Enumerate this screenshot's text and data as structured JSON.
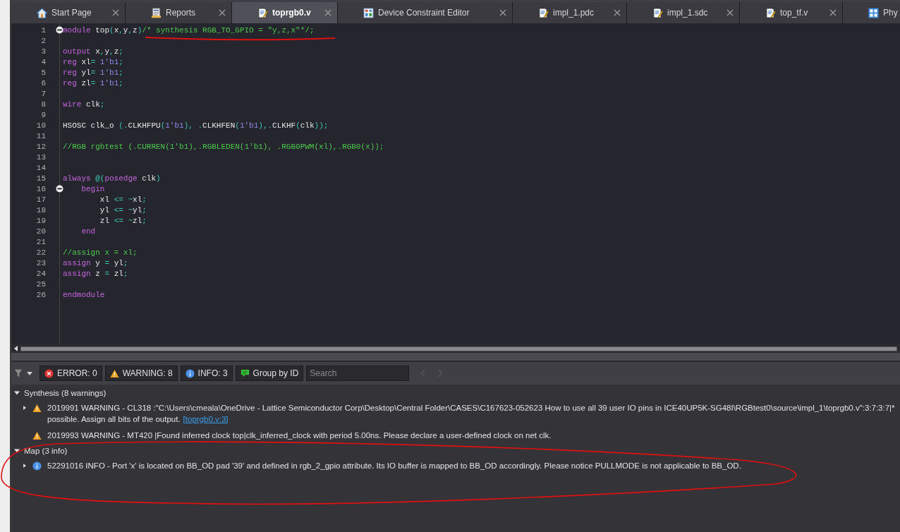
{
  "tabs": [
    {
      "label": "Start Page",
      "kind": "home",
      "selected": false,
      "closable": true
    },
    {
      "label": "Reports",
      "kind": "report",
      "selected": false,
      "closable": true
    },
    {
      "label": "toprgb0.v",
      "kind": "file",
      "selected": true,
      "closable": true
    },
    {
      "label": "Device Constraint Editor",
      "kind": "table",
      "selected": false,
      "closable": true
    },
    {
      "label": "impl_1.pdc",
      "kind": "file",
      "selected": false,
      "closable": true
    },
    {
      "label": "impl_1.sdc",
      "kind": "file",
      "selected": false,
      "closable": true
    },
    {
      "label": "top_tf.v",
      "kind": "file",
      "selected": false,
      "closable": true
    },
    {
      "label": "Phy",
      "kind": "grid",
      "selected": false,
      "closable": false
    }
  ],
  "editor": {
    "lines": [
      {
        "number": "1",
        "fold": true,
        "tokens": [
          {
            "kind": "k",
            "text": "module"
          },
          {
            "kind": "t",
            "text": " top"
          },
          {
            "kind": "p",
            "text": "("
          },
          {
            "kind": "t",
            "text": "x"
          },
          {
            "kind": "p",
            "text": ","
          },
          {
            "kind": "t",
            "text": "y"
          },
          {
            "kind": "p",
            "text": ","
          },
          {
            "kind": "t",
            "text": "z"
          },
          {
            "kind": "p",
            "text": ")"
          },
          {
            "kind": "c",
            "text": "/* synthesis RGB_TO_GPIO = \"y,z,x\"*/;"
          }
        ]
      },
      {
        "number": "2",
        "fold": false
      },
      {
        "number": "3",
        "fold": false,
        "tokens": [
          {
            "kind": "k",
            "text": "output"
          },
          {
            "kind": "t",
            "text": " x"
          },
          {
            "kind": "p",
            "text": ","
          },
          {
            "kind": "t",
            "text": "y"
          },
          {
            "kind": "p",
            "text": ","
          },
          {
            "kind": "t",
            "text": "z"
          },
          {
            "kind": "p",
            "text": ";"
          }
        ]
      },
      {
        "number": "4",
        "fold": false,
        "tokens": [
          {
            "kind": "k",
            "text": "reg"
          },
          {
            "kind": "t",
            "text": " xl"
          },
          {
            "kind": "p",
            "text": "= "
          },
          {
            "kind": "n",
            "text": "1'b1"
          },
          {
            "kind": "p",
            "text": ";"
          }
        ]
      },
      {
        "number": "5",
        "fold": false,
        "tokens": [
          {
            "kind": "k",
            "text": "reg"
          },
          {
            "kind": "t",
            "text": " yl"
          },
          {
            "kind": "p",
            "text": "= "
          },
          {
            "kind": "n",
            "text": "1'b1"
          },
          {
            "kind": "p",
            "text": ";"
          }
        ]
      },
      {
        "number": "6",
        "fold": false,
        "tokens": [
          {
            "kind": "k",
            "text": "reg"
          },
          {
            "kind": "t",
            "text": " zl"
          },
          {
            "kind": "p",
            "text": "= "
          },
          {
            "kind": "n",
            "text": "1'b1"
          },
          {
            "kind": "p",
            "text": ";"
          }
        ]
      },
      {
        "number": "7",
        "fold": false
      },
      {
        "number": "8",
        "fold": false,
        "tokens": [
          {
            "kind": "k",
            "text": "wire"
          },
          {
            "kind": "t",
            "text": " clk"
          },
          {
            "kind": "p",
            "text": ";"
          }
        ]
      },
      {
        "number": "9",
        "fold": false
      },
      {
        "number": "10",
        "fold": false,
        "tokens": [
          {
            "kind": "t",
            "text": "HSOSC clk_o "
          },
          {
            "kind": "p",
            "text": "(."
          },
          {
            "kind": "t",
            "text": "CLKHFPU"
          },
          {
            "kind": "p",
            "text": "("
          },
          {
            "kind": "n",
            "text": "1'b1"
          },
          {
            "kind": "p",
            "text": "), ."
          },
          {
            "kind": "t",
            "text": "CLKHFEN"
          },
          {
            "kind": "p",
            "text": "("
          },
          {
            "kind": "n",
            "text": "1'b1"
          },
          {
            "kind": "p",
            "text": "),."
          },
          {
            "kind": "t",
            "text": "CLKHF"
          },
          {
            "kind": "p",
            "text": "("
          },
          {
            "kind": "t",
            "text": "clk"
          },
          {
            "kind": "p",
            "text": "));"
          }
        ]
      },
      {
        "number": "11",
        "fold": false
      },
      {
        "number": "12",
        "fold": false,
        "tokens": [
          {
            "kind": "c",
            "text": "//RGB rgbtest (.CURREN(1'b1),.RGBLEDEN(1'b1), .RGB0PWM(xl),.RGB0(x));"
          }
        ]
      },
      {
        "number": "13",
        "fold": false
      },
      {
        "number": "14",
        "fold": false
      },
      {
        "number": "15",
        "fold": false,
        "tokens": [
          {
            "kind": "k",
            "text": "always"
          },
          {
            "kind": "p",
            "text": " @("
          },
          {
            "kind": "k",
            "text": "posedge"
          },
          {
            "kind": "t",
            "text": " clk"
          },
          {
            "kind": "p",
            "text": ")"
          }
        ]
      },
      {
        "number": "16",
        "fold": true,
        "tokens": [
          {
            "kind": "k",
            "text": "    begin"
          }
        ]
      },
      {
        "number": "17",
        "fold": false,
        "tokens": [
          {
            "kind": "t",
            "text": "        xl "
          },
          {
            "kind": "p",
            "text": "<= ~"
          },
          {
            "kind": "t",
            "text": "xl"
          },
          {
            "kind": "p",
            "text": ";"
          }
        ]
      },
      {
        "number": "18",
        "fold": false,
        "tokens": [
          {
            "kind": "t",
            "text": "        yl "
          },
          {
            "kind": "p",
            "text": "<= ~"
          },
          {
            "kind": "t",
            "text": "yl"
          },
          {
            "kind": "p",
            "text": ";"
          }
        ]
      },
      {
        "number": "19",
        "fold": false,
        "tokens": [
          {
            "kind": "t",
            "text": "        zl "
          },
          {
            "kind": "p",
            "text": "<= ~"
          },
          {
            "kind": "t",
            "text": "zl"
          },
          {
            "kind": "p",
            "text": ";"
          }
        ]
      },
      {
        "number": "20",
        "fold": false,
        "tokens": [
          {
            "kind": "k",
            "text": "    end"
          }
        ]
      },
      {
        "number": "21",
        "fold": false
      },
      {
        "number": "22",
        "fold": false,
        "tokens": [
          {
            "kind": "c",
            "text": "//assign x = xl;"
          }
        ]
      },
      {
        "number": "23",
        "fold": false,
        "tokens": [
          {
            "kind": "k",
            "text": "assign"
          },
          {
            "kind": "t",
            "text": " y "
          },
          {
            "kind": "p",
            "text": "="
          },
          {
            "kind": "t",
            "text": " yl"
          },
          {
            "kind": "p",
            "text": ";"
          }
        ]
      },
      {
        "number": "24",
        "fold": false,
        "tokens": [
          {
            "kind": "k",
            "text": "assign"
          },
          {
            "kind": "t",
            "text": " z "
          },
          {
            "kind": "p",
            "text": "="
          },
          {
            "kind": "t",
            "text": " zl"
          },
          {
            "kind": "p",
            "text": ";"
          }
        ]
      },
      {
        "number": "25",
        "fold": false
      },
      {
        "number": "26",
        "fold": false,
        "tokens": [
          {
            "kind": "k",
            "text": "endmodule"
          }
        ]
      }
    ]
  },
  "messages": {
    "filters": [
      {
        "kind": "error",
        "label": "ERROR: 0"
      },
      {
        "kind": "warning",
        "label": "WARNING: 8"
      },
      {
        "kind": "info",
        "label": "INFO: 3"
      },
      {
        "kind": "group",
        "label": "Group by ID"
      }
    ],
    "search": {
      "placeholder": "Search"
    },
    "groups": [
      {
        "title": "Synthesis (8 warnings)",
        "expanded": true,
        "items": [
          {
            "kind": "warning",
            "expandable": true,
            "lines": [
              "2019991 WARNING - CL318 :\"C:\\Users\\cmeala\\OneDrive - Lattice Semiconductor Corp\\Desktop\\Central Folder\\CASES\\C167623-052623 How to use all 39 user IO pins in ICE40UP5K-SG48I\\RGBtest0\\source\\impl_1\\toprgb0.v\":3:7:3:7|*",
              "possible. Assign all bits of the output."
            ],
            "link": "[toprgb0.v:3]"
          },
          {
            "kind": "warning",
            "expandable": false,
            "lines": [
              "2019993 WARNING - MT420 |Found inferred clock top|clk_inferred_clock with period 5.00ns. Please declare a user-defined clock on net clk."
            ]
          }
        ]
      },
      {
        "title": "Map (3 info)",
        "expanded": true,
        "items": [
          {
            "kind": "info",
            "expandable": true,
            "lines": [
              "52291016 INFO - Port 'x' is located on BB_OD pad '39' and defined in rgb_2_gpio attribute. Its IO buffer is mapped to BB_OD accordingly. Please notice PULLMODE is not applicable to BB_OD."
            ]
          }
        ]
      }
    ]
  }
}
